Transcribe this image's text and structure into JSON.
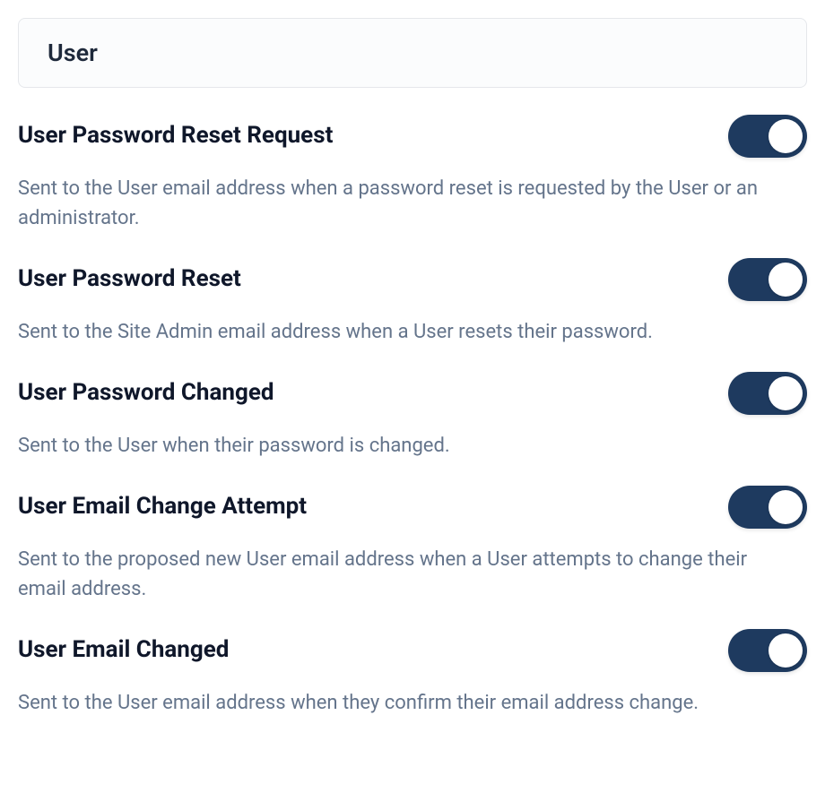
{
  "section": {
    "title": "User"
  },
  "settings": [
    {
      "id": "user-password-reset-request",
      "title": "User Password Reset Request",
      "description": "Sent to the User email address when a password reset is requested by the User or an administrator.",
      "enabled": true
    },
    {
      "id": "user-password-reset",
      "title": "User Password Reset",
      "description": "Sent to the Site Admin email address when a User resets their password.",
      "enabled": true
    },
    {
      "id": "user-password-changed",
      "title": "User Password Changed",
      "description": "Sent to the User when their password is changed.",
      "enabled": true
    },
    {
      "id": "user-email-change-attempt",
      "title": "User Email Change Attempt",
      "description": "Sent to the proposed new User email address when a User attempts to change their email address.",
      "enabled": true
    },
    {
      "id": "user-email-changed",
      "title": "User Email Changed",
      "description": "Sent to the User email address when they confirm their email address change.",
      "enabled": true
    }
  ]
}
